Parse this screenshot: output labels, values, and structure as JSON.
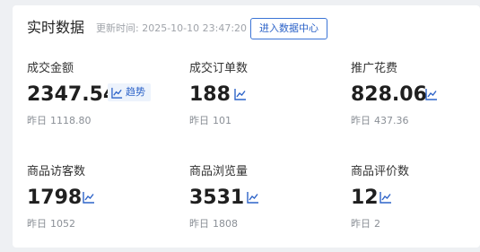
{
  "header": {
    "title": "实时数据",
    "updated_label": "更新时间:",
    "updated_time": "2025-10-10 23:47:20",
    "enter_button_label": "进入数据中心"
  },
  "colors": {
    "accent": "#2d63c8",
    "trend_bg": "#edf3fc",
    "page_bg": "#eef0f3"
  },
  "trend_button_label": "趋势",
  "prev_label": "昨日",
  "metrics": [
    {
      "label": "成交金额",
      "value": "2347.54",
      "prev": "1118.80",
      "icon": "trend-line-icon"
    },
    {
      "label": "成交订单数",
      "value": "188",
      "prev": "101",
      "icon": "trend-line-icon"
    },
    {
      "label": "推广花费",
      "value": "828.06",
      "prev": "437.36",
      "icon": "trend-line-icon"
    },
    {
      "label": "商品访客数",
      "value": "1798",
      "prev": "1052",
      "icon": "trend-line-icon"
    },
    {
      "label": "商品浏览量",
      "value": "3531",
      "prev": "1808",
      "icon": "trend-line-icon"
    },
    {
      "label": "商品评价数",
      "value": "12",
      "prev": "2",
      "icon": "trend-line-icon"
    }
  ]
}
